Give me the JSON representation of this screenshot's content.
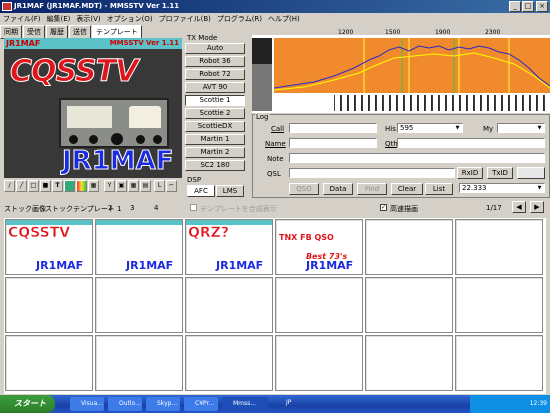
{
  "window": {
    "title": "JR1MAF (JR1MAF.MDT) - MMSSTV Ver 1.11"
  },
  "menu": [
    "ファイル(F)",
    "編集(E)",
    "表示(V)",
    "オプション(O)",
    "プロファイル(B)",
    "プログラム(R)",
    "ヘルプ(H)"
  ],
  "tabs": [
    {
      "label": "同期"
    },
    {
      "label": "受信"
    },
    {
      "label": "履歴"
    },
    {
      "label": "送信"
    },
    {
      "label": "テンプレート",
      "active": true
    }
  ],
  "image": {
    "header_left": "JR1MAF",
    "header_right": "MMSSTV Ver 1.11",
    "big_text": "CQSSTV",
    "callsign": "JR1MAF"
  },
  "txmode": {
    "title": "TX Mode",
    "buttons": [
      "Auto",
      "Robot 36",
      "Robot 72",
      "AVT 90",
      "Scottie 1",
      "Scottie 2",
      "ScottieDX",
      "Martin 1",
      "Martin 2",
      "SC2 180"
    ],
    "selected": "Scottie 1"
  },
  "dsp": {
    "title": "DSP",
    "buttons": [
      "AFC",
      "LMS"
    ]
  },
  "spectrum": {
    "ticks": [
      "1200",
      "1500",
      "1900",
      "2300"
    ]
  },
  "log": {
    "title": "Log",
    "labels": {
      "call": "Call",
      "his": "His",
      "my": "My",
      "name": "Name",
      "qth": "Qth",
      "note": "Note",
      "qsl": "QSL"
    },
    "his_value": "595",
    "buttons": {
      "rxid": "RxID",
      "txid": "TxID",
      "qso": "QSO",
      "data": "Data",
      "find": "Find",
      "clear": "Clear",
      "list": "List"
    },
    "frequency": "22.333"
  },
  "stock": {
    "tabs": [
      "ストック画像",
      "ストックテンプレート 1",
      "2",
      "3",
      "4"
    ],
    "checkbox1_label": "テンプレートを合成表示",
    "checkbox2_label": "高速描画",
    "page": "1/17"
  },
  "templates": [
    {
      "text": "CQSSTV",
      "call": "JR1MAF",
      "kind": "cq"
    },
    {
      "text": "",
      "call": "JR1MAF",
      "kind": "blank"
    },
    {
      "text": "QRZ?",
      "call": "JR1MAF",
      "kind": "qrz"
    },
    {
      "text": "TNX FB QSO",
      "sub": "Best 73's",
      "call": "JR1MAF",
      "kind": "tnx"
    }
  ],
  "taskbar": {
    "start": "スタート",
    "tasks": [
      "Visua...",
      "Outlo...",
      "Skyp...",
      "C¥Pr...",
      "Mmss..."
    ],
    "ime": "JP",
    "clock": "12:39"
  }
}
